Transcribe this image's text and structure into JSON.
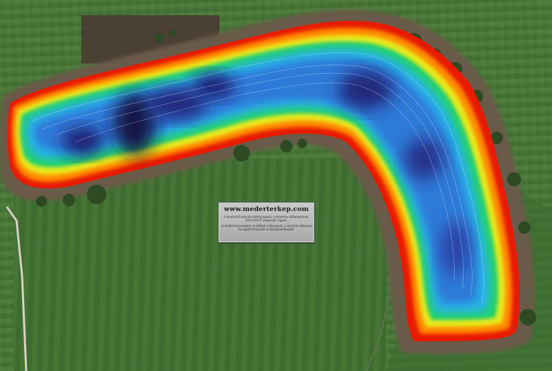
{
  "watermark": {
    "url": "www.mederterkep.com",
    "lines1": [
      "A mederről készült térkép adatai a felmérés időpontjának,",
      "2020.08.07 állapotát rögzíti."
    ],
    "lines2": [
      "A mederviszonyokat az időbeli változások, a vízszint változása",
      "és egyéb tényezők is befolyásolhatják!"
    ]
  },
  "colors": {
    "field_light": "#4f7f3e",
    "field_dark": "#305a28",
    "deep": "#1b1d6e",
    "mid": "#2d7ad8",
    "shallow_blue": "#27b3e8",
    "green": "#21d26a",
    "yellow": "#e8ea1c",
    "orange": "#ff8a00",
    "red": "#e81a00"
  },
  "map_layers": [
    "satellite-background",
    "bathymetry-lake",
    "depth-contours",
    "tree-line"
  ]
}
